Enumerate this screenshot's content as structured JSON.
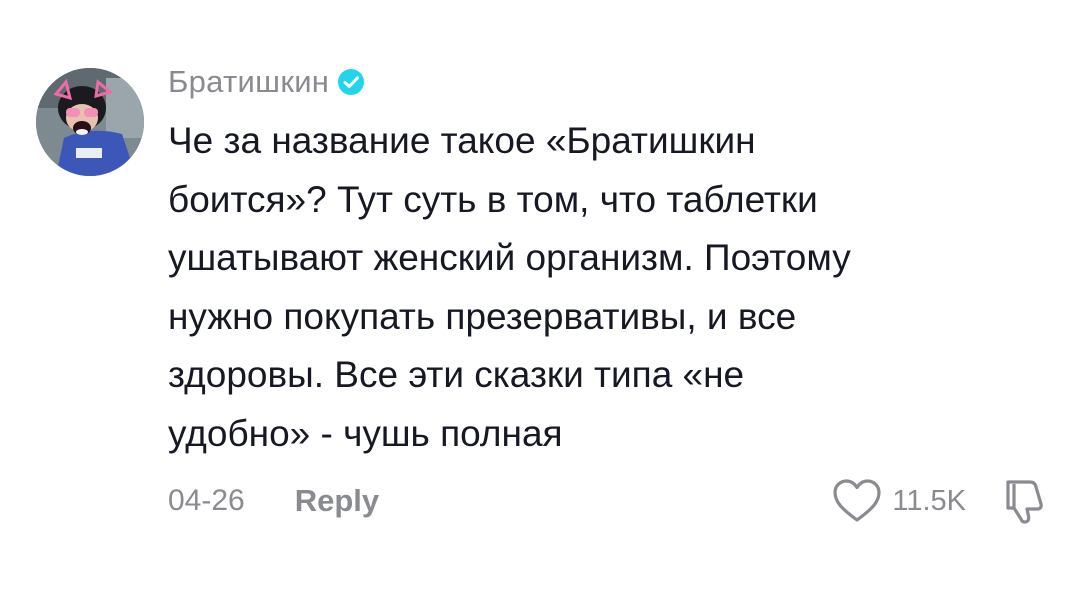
{
  "comment": {
    "username": "Братишкин",
    "verified": true,
    "text": "Че за название такое «Братишкин боится»? Тут суть в том, что таблетки ушатывают женский организм. Поэтому нужно покупать презервативы, и все здоровы. Все эти сказки типа «не удобно» - чушь полная",
    "lines": [
      "Че за название такое «Братишкин",
      "боится»? Тут суть в том, что таблетки",
      "ушатывают женский организм. Поэтому",
      "нужно покупать презервативы, и все",
      "здоровы. Все эти сказки типа «не",
      "удобно» - чушь полная"
    ],
    "date": "04-26",
    "reply_label": "Reply",
    "like_count": "11.5K",
    "icons": {
      "verified": "verified-badge-icon",
      "like": "heart-outline-icon",
      "dislike": "thumbs-down-outline-icon"
    },
    "colors": {
      "text": "#161823",
      "secondary": "#8a8b91",
      "verified": "#20d5ec"
    }
  }
}
